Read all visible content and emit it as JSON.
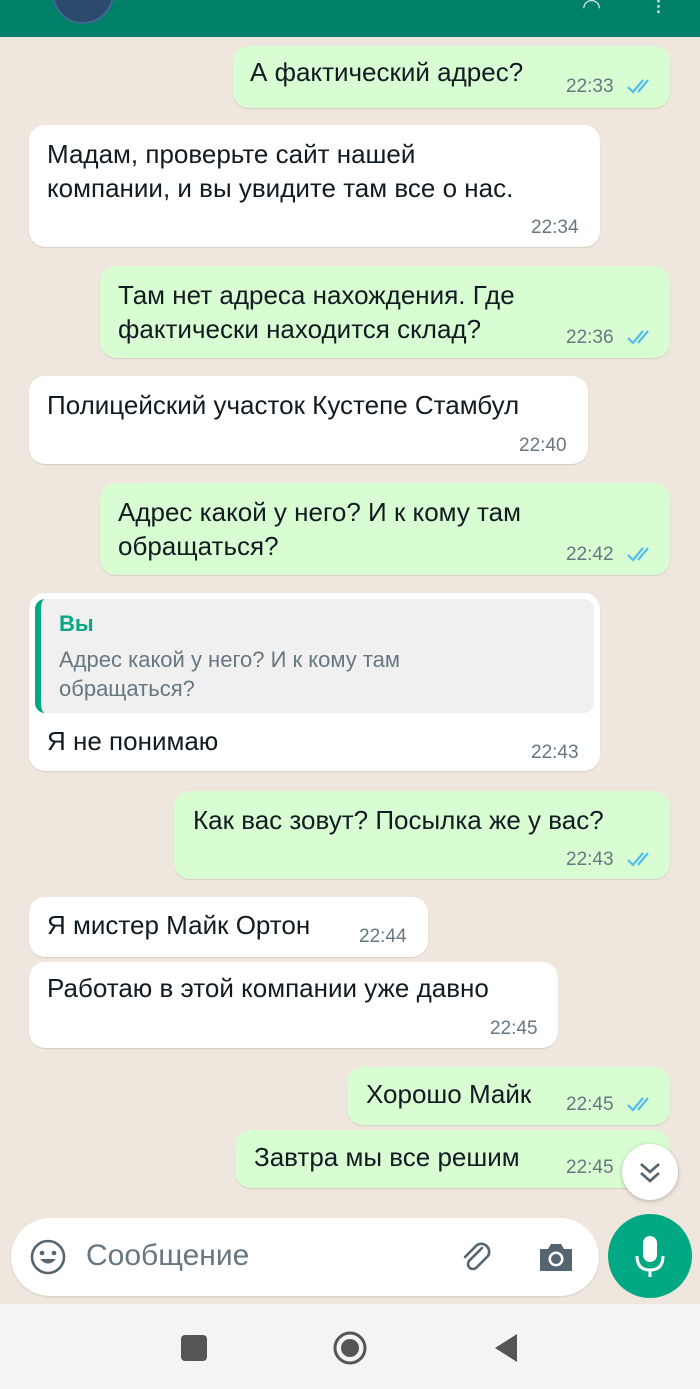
{
  "colors": {
    "header": "#008069",
    "outgoing_bubble": "#d9fdd3",
    "incoming_bubble": "#ffffff",
    "read_ticks": "#53bdeb",
    "accent": "#00a884"
  },
  "messages": [
    {
      "dir": "out",
      "text": "А фактический адрес?",
      "time": "22:33",
      "status": "read"
    },
    {
      "dir": "in",
      "text": "Мадам, проверьте сайт нашей\nкомпании, и вы увидите там все о нас.",
      "time": "22:34"
    },
    {
      "dir": "out",
      "text": "Там нет адреса нахождения. Где\nфактически находится склад?",
      "time": "22:36",
      "status": "read"
    },
    {
      "dir": "in",
      "text": "Полицейский участок Кустепе Стамбул",
      "time": "22:40"
    },
    {
      "dir": "out",
      "text": "Адрес какой у него? И к кому там\nобращаться?",
      "time": "22:42",
      "status": "read"
    },
    {
      "dir": "in",
      "reply": {
        "author": "Вы",
        "text": "Адрес какой у него? И к кому там\nобращаться?"
      },
      "text": "Я не понимаю",
      "time": "22:43"
    },
    {
      "dir": "out",
      "text": "Как вас зовут? Посылка же у вас?",
      "time": "22:43",
      "status": "read"
    },
    {
      "dir": "in",
      "text": "Я мистер Майк Ортон",
      "time": "22:44"
    },
    {
      "dir": "in",
      "text": "Работаю в этой компании уже давно",
      "time": "22:45"
    },
    {
      "dir": "out",
      "text": "Хорошо Майк",
      "time": "22:45",
      "status": "read"
    },
    {
      "dir": "out",
      "text": "Завтра мы все решим",
      "time": "22:45",
      "status": "read"
    }
  ],
  "composer": {
    "placeholder": "Сообщение",
    "emoji_icon": "emoji-icon",
    "attach_icon": "paperclip-icon",
    "camera_icon": "camera-icon",
    "mic_icon": "microphone-icon"
  },
  "scroll_button_icon": "double-chevron-down-icon",
  "navbar": {
    "icons": [
      "recent-apps-icon",
      "home-icon",
      "back-icon"
    ]
  }
}
